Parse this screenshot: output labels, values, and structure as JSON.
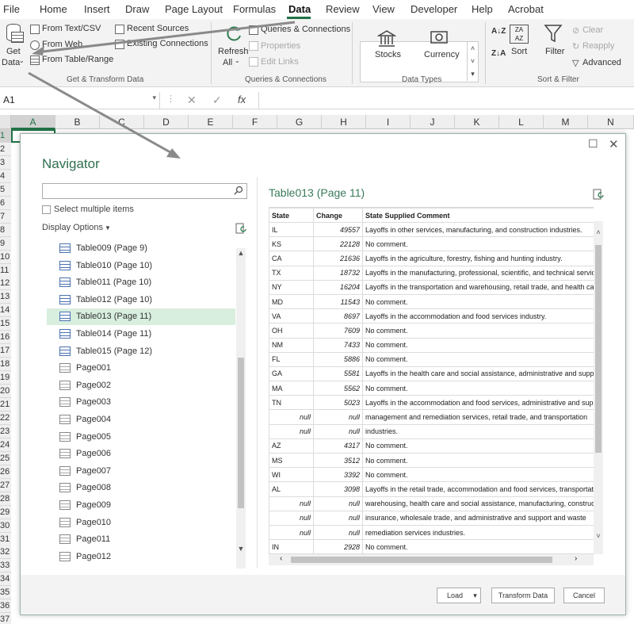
{
  "menu": {
    "tabs": [
      "File",
      "Home",
      "Insert",
      "Draw",
      "Page Layout",
      "Formulas",
      "Data",
      "Review",
      "View",
      "Developer",
      "Help",
      "Acrobat"
    ],
    "active": "Data"
  },
  "ribbon": {
    "get_data_line1": "Get",
    "get_data_line2": "Data",
    "from_text_csv": "From Text/CSV",
    "from_web": "From Web",
    "from_table_range": "From Table/Range",
    "recent_sources": "Recent Sources",
    "existing_connections": "Existing Connections",
    "group_get_transform": "Get & Transform Data",
    "refresh_line1": "Refresh",
    "refresh_line2": "All",
    "queries_connections": "Queries & Connections",
    "properties": "Properties",
    "edit_links": "Edit Links",
    "group_queries": "Queries & Connections",
    "stocks": "Stocks",
    "currency": "Currency",
    "group_data_types": "Data Types",
    "sort": "Sort",
    "filter": "Filter",
    "clear": "Clear",
    "reapply": "Reapply",
    "advanced": "Advanced",
    "group_sort_filter": "Sort & Filter"
  },
  "formula_bar": {
    "name_box": "A1",
    "fx": "fx"
  },
  "grid": {
    "columns": [
      "A",
      "B",
      "C",
      "D",
      "E",
      "F",
      "G",
      "H",
      "I",
      "J",
      "K",
      "L",
      "M",
      "N"
    ],
    "rows": [
      "1",
      "2",
      "3",
      "4",
      "5",
      "6",
      "7",
      "8",
      "9",
      "10",
      "11",
      "12",
      "13",
      "14",
      "15",
      "16",
      "17",
      "18",
      "19",
      "20",
      "21",
      "22",
      "23",
      "24",
      "25",
      "26",
      "27",
      "28",
      "29",
      "30",
      "31",
      "32",
      "33",
      "34",
      "35",
      "36",
      "37"
    ]
  },
  "navigator": {
    "title": "Navigator",
    "search_placeholder": "",
    "select_multiple": "Select multiple items",
    "display_options": "Display Options",
    "items": [
      {
        "label": "Table009 (Page 9)",
        "kind": "table"
      },
      {
        "label": "Table010 (Page 10)",
        "kind": "table"
      },
      {
        "label": "Table011 (Page 10)",
        "kind": "table"
      },
      {
        "label": "Table012 (Page 10)",
        "kind": "table"
      },
      {
        "label": "Table013 (Page 11)",
        "kind": "table",
        "selected": true
      },
      {
        "label": "Table014 (Page 11)",
        "kind": "table"
      },
      {
        "label": "Table015 (Page 12)",
        "kind": "table"
      },
      {
        "label": "Page001",
        "kind": "page"
      },
      {
        "label": "Page002",
        "kind": "page"
      },
      {
        "label": "Page003",
        "kind": "page"
      },
      {
        "label": "Page004",
        "kind": "page"
      },
      {
        "label": "Page005",
        "kind": "page"
      },
      {
        "label": "Page006",
        "kind": "page"
      },
      {
        "label": "Page007",
        "kind": "page"
      },
      {
        "label": "Page008",
        "kind": "page"
      },
      {
        "label": "Page009",
        "kind": "page"
      },
      {
        "label": "Page010",
        "kind": "page"
      },
      {
        "label": "Page011",
        "kind": "page"
      },
      {
        "label": "Page012",
        "kind": "page"
      }
    ],
    "preview_title": "Table013 (Page 11)",
    "columns": [
      "State",
      "Change",
      "State Supplied Comment"
    ],
    "rows": [
      [
        "IL",
        "49557",
        "Layoffs in other services, manufacturing, and construction industries."
      ],
      [
        "KS",
        "22128",
        "No comment."
      ],
      [
        "CA",
        "21636",
        "Layoffs in the agriculture, forestry, fishing and hunting industry."
      ],
      [
        "TX",
        "18732",
        "Layoffs in the manufacturing, professional, scientific, and technical services"
      ],
      [
        "NY",
        "16204",
        "Layoffs in the transportation and warehousing, retail trade, and health care"
      ],
      [
        "MD",
        "11543",
        "No comment."
      ],
      [
        "VA",
        "8697",
        "Layoffs in the accommodation and food services industry."
      ],
      [
        "OH",
        "7609",
        "No comment."
      ],
      [
        "NM",
        "7433",
        "No comment."
      ],
      [
        "FL",
        "5886",
        "No comment."
      ],
      [
        "GA",
        "5581",
        "Layoffs in the health care and social assistance, administrative and support"
      ],
      [
        "MA",
        "5562",
        "No comment."
      ],
      [
        "TN",
        "5023",
        "Layoffs in the accommodation and food services, administrative and support"
      ],
      [
        "null",
        "null",
        "management and remediation services, retail trade, and transportation"
      ],
      [
        "null",
        "null",
        "industries."
      ],
      [
        "AZ",
        "4317",
        "No comment."
      ],
      [
        "MS",
        "3512",
        "No comment."
      ],
      [
        "WI",
        "3392",
        "No comment."
      ],
      [
        "AL",
        "3098",
        "Layoffs in the retail trade, accommodation and food services, transportation"
      ],
      [
        "null",
        "null",
        "warehousing, health care and social assistance, manufacturing, construction"
      ],
      [
        "null",
        "null",
        "insurance, wholesale trade, and administrative and support and waste"
      ],
      [
        "null",
        "null",
        "remediation services industries."
      ],
      [
        "IN",
        "2928",
        "No comment."
      ]
    ],
    "buttons": {
      "load": "Load",
      "transform": "Transform Data",
      "cancel": "Cancel"
    }
  },
  "colors": {
    "excel_green": "#217346",
    "selected_row": "#d8eedf",
    "dialog_title": "#2f6f4f"
  }
}
